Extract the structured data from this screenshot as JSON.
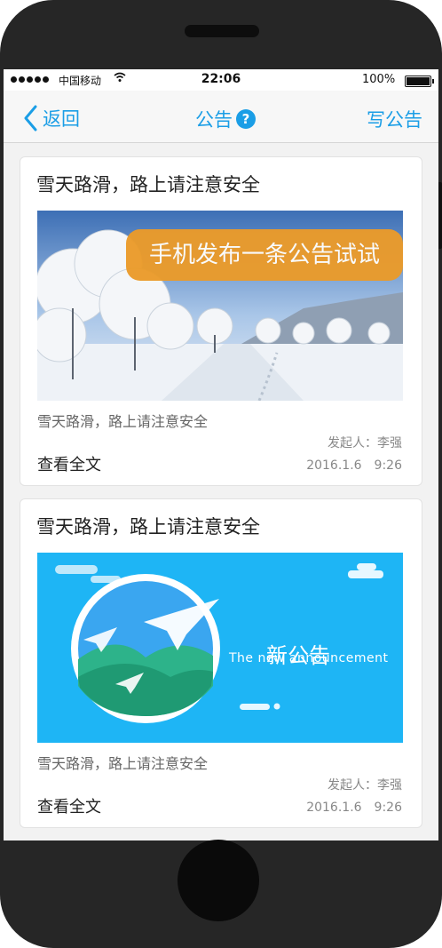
{
  "status_bar": {
    "carrier": "中国移动",
    "time": "22:06",
    "battery": "100%"
  },
  "navbar": {
    "back_label": "返回",
    "title": "公告",
    "help_glyph": "?",
    "compose_label": "写公告"
  },
  "tooltip": "手机发布一条公告试试",
  "cards": [
    {
      "title": "雪天路滑，路上请注意安全",
      "summary": "雪天路滑，路上请注意安全",
      "author": "发起人：李强",
      "date": "2016.1.6　9:26",
      "read_more": "查看全文",
      "image": "snow-landscape"
    },
    {
      "title": "雪天路滑，路上请注意安全",
      "summary": "雪天路滑，路上请注意安全",
      "author": "发起人：李强",
      "date": "2016.1.6　9:26",
      "read_more": "查看全文",
      "image": "paper-plane-banner",
      "banner_title": "新公告",
      "banner_subtitle": "The new announcement"
    }
  ],
  "colors": {
    "accent": "#1b9ee6",
    "tooltip": "#eb9b2a",
    "banner_bg": "#1eb5f5"
  }
}
